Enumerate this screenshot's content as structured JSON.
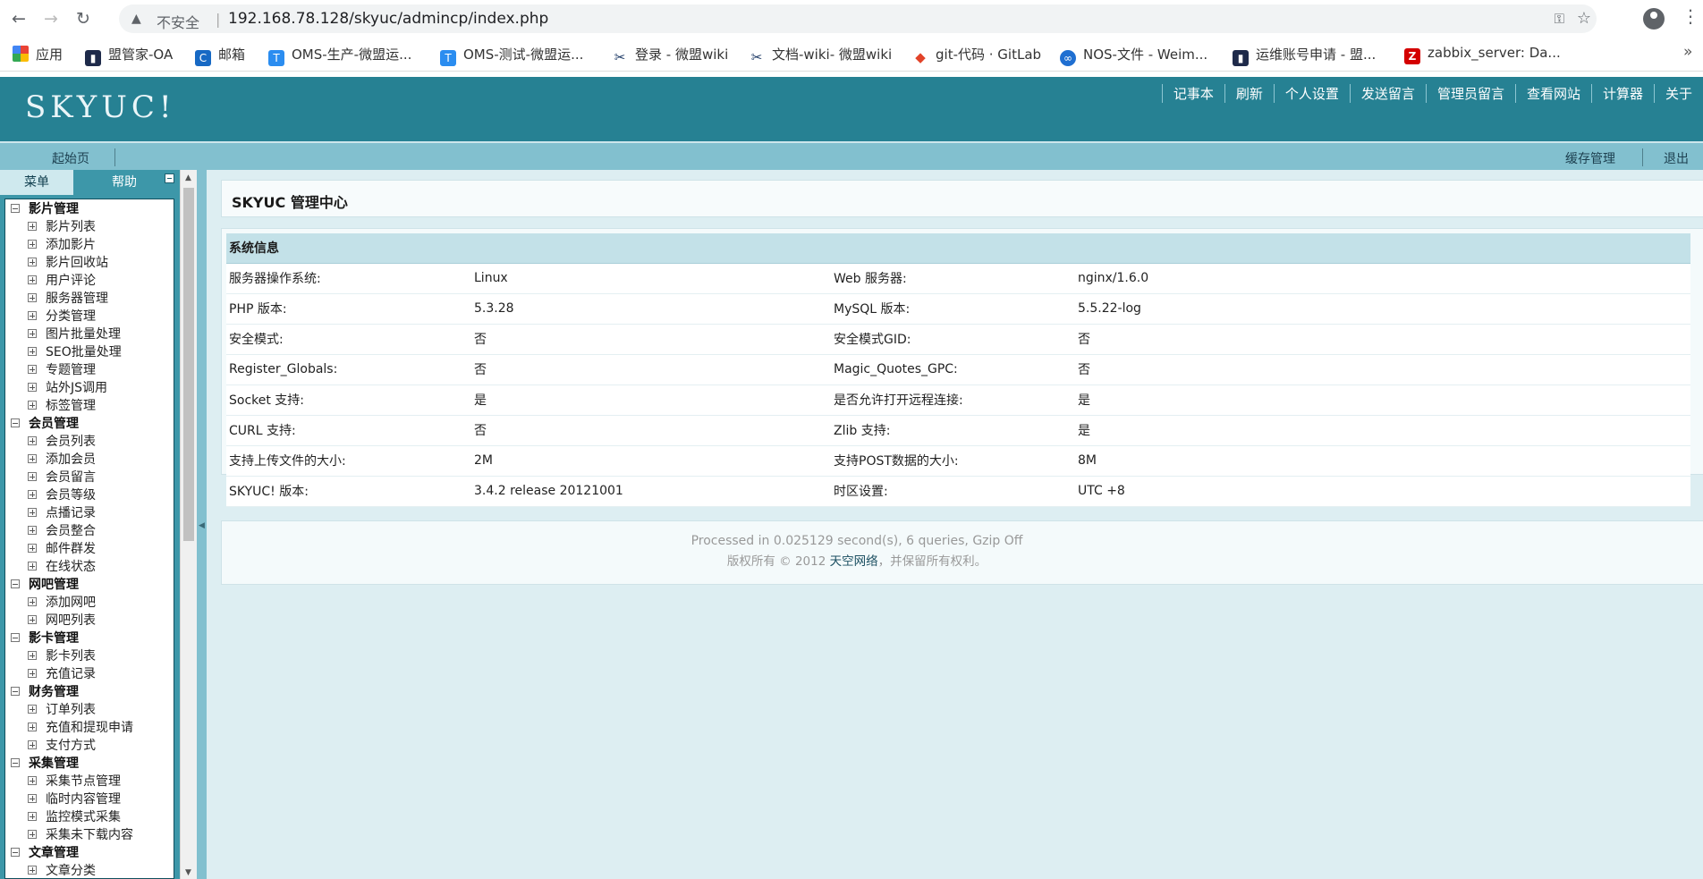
{
  "browser": {
    "insecure_label": "不安全",
    "url_separator": "|",
    "url": "192.168.78.128/skyuc/admincp/index.php",
    "bookmarks": [
      {
        "label": "应用",
        "icon": "apps-grid-icon"
      },
      {
        "label": "盟管家-OA",
        "icon": "oa-icon"
      },
      {
        "label": "邮箱",
        "icon": "mail-icon"
      },
      {
        "label": "OMS-生产-微盟运...",
        "icon": "t-icon"
      },
      {
        "label": "OMS-测试-微盟运...",
        "icon": "t-icon"
      },
      {
        "label": "登录 - 微盟wiki",
        "icon": "wiki-icon"
      },
      {
        "label": "文档-wiki- 微盟wiki",
        "icon": "wiki-icon"
      },
      {
        "label": "git-代码 · GitLab",
        "icon": "gitlab-icon"
      },
      {
        "label": "NOS-文件 - Weim...",
        "icon": "nos-icon"
      },
      {
        "label": "运维账号申请 - 盟...",
        "icon": "oa-icon"
      },
      {
        "label": "zabbix_server: Da...",
        "icon": "zabbix-icon"
      }
    ],
    "bookmark_icon_letters": {
      "mail": "C",
      "t": "T",
      "wiki": "✂",
      "gitlab": "◆",
      "nos": "∞",
      "oa": "▮",
      "zabbix": "Z"
    },
    "bookmark_more": "»"
  },
  "header": {
    "logo": "SKYUC!",
    "links": [
      "记事本",
      "刷新",
      "个人设置",
      "发送留言",
      "管理员留言",
      "查看网站",
      "计算器",
      "关于"
    ]
  },
  "subbar": {
    "home": "起始页",
    "cache": "缓存管理",
    "logout": "退出"
  },
  "sidebar": {
    "tabs": {
      "menu": "菜单",
      "help": "帮助"
    },
    "groups": [
      {
        "title": "影片管理",
        "items": [
          "影片列表",
          "添加影片",
          "影片回收站",
          "用户评论",
          "服务器管理",
          "分类管理",
          "图片批量处理",
          "SEO批量处理",
          "专题管理",
          "站外JS调用",
          "标签管理"
        ]
      },
      {
        "title": "会员管理",
        "items": [
          "会员列表",
          "添加会员",
          "会员留言",
          "会员等级",
          "点播记录",
          "会员整合",
          "邮件群发",
          "在线状态"
        ]
      },
      {
        "title": "网吧管理",
        "items": [
          "添加网吧",
          "网吧列表"
        ]
      },
      {
        "title": "影卡管理",
        "items": [
          "影卡列表",
          "充值记录"
        ]
      },
      {
        "title": "财务管理",
        "items": [
          "订单列表",
          "充值和提现申请",
          "支付方式"
        ]
      },
      {
        "title": "采集管理",
        "items": [
          "采集节点管理",
          "临时内容管理",
          "监控模式采集",
          "采集未下载内容"
        ]
      },
      {
        "title": "文章管理",
        "items": [
          "文章分类"
        ]
      }
    ]
  },
  "main": {
    "title": "SKYUC 管理中心",
    "sysinfo_title": "系统信息",
    "rows": [
      [
        "服务器操作系统:",
        "Linux",
        "Web 服务器:",
        "nginx/1.6.0"
      ],
      [
        "PHP 版本:",
        "5.3.28",
        "MySQL 版本:",
        "5.5.22-log"
      ],
      [
        "安全模式:",
        "否",
        "安全模式GID:",
        "否"
      ],
      [
        "Register_Globals:",
        "否",
        "Magic_Quotes_GPC:",
        "否"
      ],
      [
        "Socket 支持:",
        "是",
        "是否允许打开远程连接:",
        "是"
      ],
      [
        "CURL 支持:",
        "否",
        "Zlib 支持:",
        "是"
      ],
      [
        "支持上传文件的大小:",
        "2M",
        "支持POST数据的大小:",
        "8M"
      ],
      [
        "SKYUC! 版本:",
        "3.4.2 release 20121001",
        "时区设置:",
        "UTC +8"
      ]
    ],
    "footer": {
      "processed": "Processed in 0.025129 second(s), 6 queries, Gzip Off",
      "copyright_pre": "版权所有 © 2012 ",
      "company": "天空网络",
      "copyright_post": "，并保留所有权利。"
    }
  }
}
